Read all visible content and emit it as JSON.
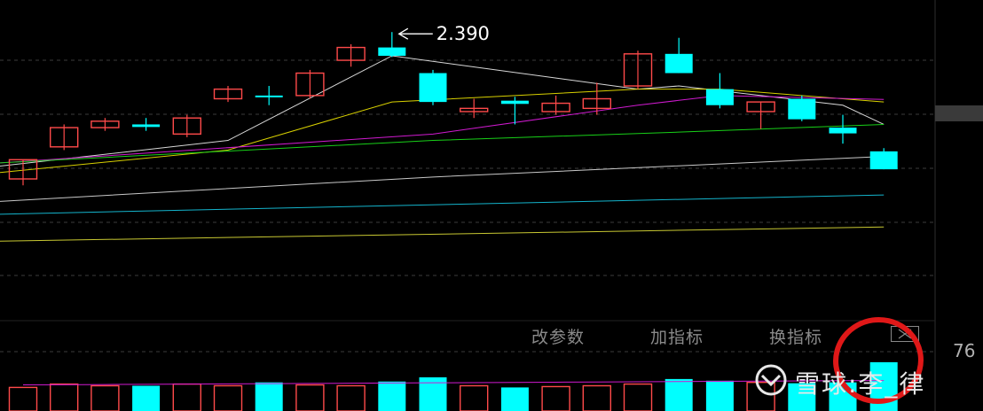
{
  "chart_data": {
    "type": "candlestick",
    "xlabel": "",
    "ylabel": "",
    "ylim": [
      1.94,
      2.44
    ],
    "volume_ylim": [
      0,
      80
    ],
    "high_annotation": "2.390",
    "candles": [
      {
        "o": 2.161,
        "h": 2.191,
        "l": 2.151,
        "c": 2.191,
        "v": 28,
        "up": true
      },
      {
        "o": 2.211,
        "h": 2.246,
        "l": 2.206,
        "c": 2.241,
        "v": 32,
        "up": true
      },
      {
        "o": 2.241,
        "h": 2.256,
        "l": 2.236,
        "c": 2.251,
        "v": 30,
        "up": true
      },
      {
        "o": 2.246,
        "h": 2.256,
        "l": 2.236,
        "c": 2.242,
        "v": 30,
        "up": false
      },
      {
        "o": 2.256,
        "h": 2.261,
        "l": 2.226,
        "c": 2.231,
        "v": 32,
        "up": true
      },
      {
        "o": 2.286,
        "h": 2.306,
        "l": 2.281,
        "c": 2.301,
        "v": 30,
        "up": true
      },
      {
        "o": 2.291,
        "h": 2.306,
        "l": 2.276,
        "c": 2.289,
        "v": 34,
        "up": false
      },
      {
        "o": 2.291,
        "h": 2.331,
        "l": 2.286,
        "c": 2.326,
        "v": 31,
        "up": true
      },
      {
        "o": 2.346,
        "h": 2.371,
        "l": 2.336,
        "c": 2.366,
        "v": 30,
        "up": true
      },
      {
        "o": 2.366,
        "h": 2.39,
        "l": 2.351,
        "c": 2.353,
        "v": 35,
        "up": false
      },
      {
        "o": 2.326,
        "h": 2.331,
        "l": 2.276,
        "c": 2.281,
        "v": 40,
        "up": false
      },
      {
        "o": 2.266,
        "h": 2.286,
        "l": 2.256,
        "c": 2.271,
        "v": 30,
        "up": true
      },
      {
        "o": 2.283,
        "h": 2.289,
        "l": 2.246,
        "c": 2.278,
        "v": 28,
        "up": false
      },
      {
        "o": 2.266,
        "h": 2.291,
        "l": 2.261,
        "c": 2.279,
        "v": 29,
        "up": true
      },
      {
        "o": 2.271,
        "h": 2.311,
        "l": 2.261,
        "c": 2.286,
        "v": 30,
        "up": true
      },
      {
        "o": 2.306,
        "h": 2.361,
        "l": 2.301,
        "c": 2.356,
        "v": 32,
        "up": true
      },
      {
        "o": 2.356,
        "h": 2.381,
        "l": 2.326,
        "c": 2.326,
        "v": 38,
        "up": false
      },
      {
        "o": 2.301,
        "h": 2.326,
        "l": 2.271,
        "c": 2.276,
        "v": 36,
        "up": false
      },
      {
        "o": 2.266,
        "h": 2.281,
        "l": 2.239,
        "c": 2.281,
        "v": 34,
        "up": true
      },
      {
        "o": 2.286,
        "h": 2.291,
        "l": 2.251,
        "c": 2.254,
        "v": 33,
        "up": false
      },
      {
        "o": 2.241,
        "h": 2.261,
        "l": 2.216,
        "c": 2.232,
        "v": 34,
        "up": false
      },
      {
        "o": 2.204,
        "h": 2.209,
        "l": 2.176,
        "c": 2.176,
        "v": 58,
        "up": false
      }
    ],
    "ma_lines": [
      {
        "color": "#d8d8d8",
        "points": [
          [
            0,
            2.181
          ],
          [
            5,
            2.221
          ],
          [
            9,
            2.353
          ],
          [
            15,
            2.301
          ],
          [
            16,
            2.306
          ],
          [
            20,
            2.276
          ],
          [
            21,
            2.246
          ]
        ]
      },
      {
        "color": "#d8d000",
        "points": [
          [
            0,
            2.171
          ],
          [
            5,
            2.206
          ],
          [
            9,
            2.281
          ],
          [
            15,
            2.301
          ],
          [
            17,
            2.301
          ],
          [
            21,
            2.281
          ]
        ]
      },
      {
        "color": "#d01ad0",
        "points": [
          [
            0,
            2.186
          ],
          [
            10,
            2.231
          ],
          [
            15,
            2.276
          ],
          [
            17,
            2.291
          ],
          [
            21,
            2.285
          ]
        ]
      },
      {
        "color": "#18d018",
        "points": [
          [
            0,
            2.186
          ],
          [
            10,
            2.221
          ],
          [
            16,
            2.234
          ],
          [
            21,
            2.246
          ]
        ]
      },
      {
        "color": "#c8c8c8",
        "points": [
          [
            0,
            2.126
          ],
          [
            10,
            2.164
          ],
          [
            21,
            2.196
          ]
        ]
      },
      {
        "color": "#14b4cc",
        "points": [
          [
            0,
            2.106
          ],
          [
            21,
            2.136
          ]
        ]
      },
      {
        "color": "#c8c832",
        "points": [
          [
            0,
            2.064
          ],
          [
            21,
            2.086
          ]
        ]
      }
    ]
  },
  "toolbar": {
    "modify_params": "改参数",
    "add_indicator": "加指标",
    "switch_indicator": "换指标"
  },
  "volume_axis_label": "76",
  "watermark": {
    "text": "雪球:李_律"
  },
  "colors": {
    "up": "#ff4a4a",
    "down": "#00ffff",
    "grid": "#3c3c3c"
  }
}
